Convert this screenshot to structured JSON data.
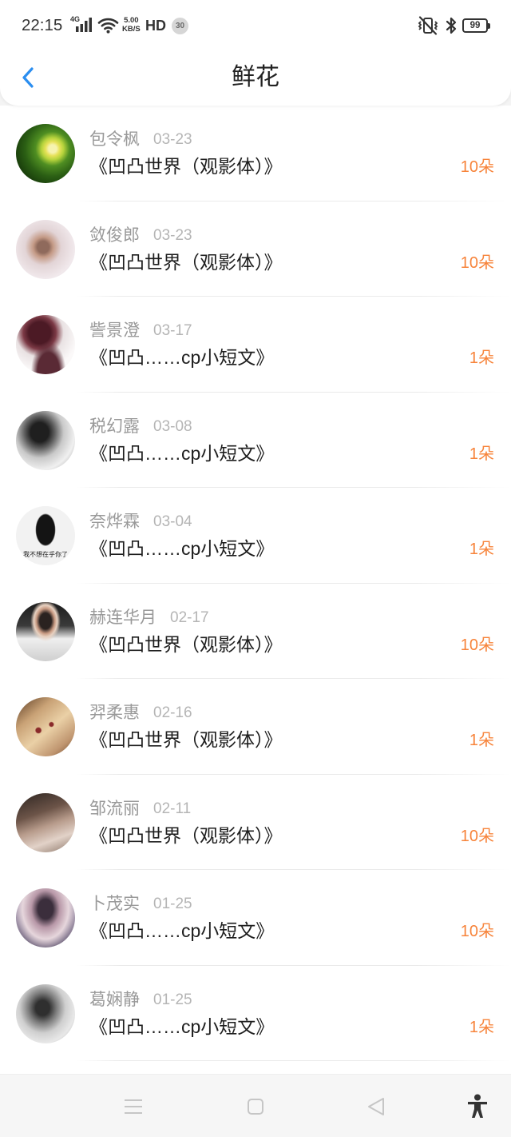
{
  "status_bar": {
    "time": "22:15",
    "network_type": "4G",
    "net_speed": "5.00",
    "net_speed_unit": "KB/S",
    "hd_label": "HD",
    "notification_badge": "30",
    "battery_level": "99",
    "icons": [
      "signal-icon",
      "wifi-icon",
      "vibrate-off-icon",
      "bluetooth-icon",
      "battery-icon"
    ]
  },
  "header": {
    "back_icon": "chevron-left-icon",
    "title": "鲜花"
  },
  "gifts": [
    {
      "name": "包令枫",
      "date": "03-23",
      "work": "《凹凸世界（观影体）》",
      "amount": "10朵"
    },
    {
      "name": "敛俊郎",
      "date": "03-23",
      "work": "《凹凸世界（观影体）》",
      "amount": "10朵"
    },
    {
      "name": "訾景澄",
      "date": "03-17",
      "work": "《凹凸……cp小短文》",
      "amount": "1朵"
    },
    {
      "name": "税幻露",
      "date": "03-08",
      "work": "《凹凸……cp小短文》",
      "amount": "1朵"
    },
    {
      "name": "奈烨霖",
      "date": "03-04",
      "work": "《凹凸……cp小短文》",
      "amount": "1朵",
      "avatar_caption": "我不想在乎你了"
    },
    {
      "name": "赫连华月",
      "date": "02-17",
      "work": "《凹凸世界（观影体）》",
      "amount": "10朵"
    },
    {
      "name": "羿柔惠",
      "date": "02-16",
      "work": "《凹凸世界（观影体）》",
      "amount": "1朵"
    },
    {
      "name": "邹流丽",
      "date": "02-11",
      "work": "《凹凸世界（观影体）》",
      "amount": "10朵"
    },
    {
      "name": "卜茂实",
      "date": "01-25",
      "work": "《凹凸……cp小短文》",
      "amount": "10朵"
    },
    {
      "name": "葛娴静",
      "date": "01-25",
      "work": "《凹凸……cp小短文》",
      "amount": "1朵"
    }
  ],
  "nav_bar": {
    "buttons": [
      {
        "icon": "menu-icon"
      },
      {
        "icon": "home-square-icon"
      },
      {
        "icon": "back-triangle-icon"
      },
      {
        "icon": "accessibility-icon"
      }
    ]
  },
  "colors": {
    "accent": "#2b8ef0",
    "amount": "#f7843b",
    "title_text": "#1e1e1e",
    "name_text": "#999999",
    "date_text": "#b5b5b5",
    "nav_bg": "#f6f6f6",
    "nav_icon": "#c6c6c6"
  }
}
